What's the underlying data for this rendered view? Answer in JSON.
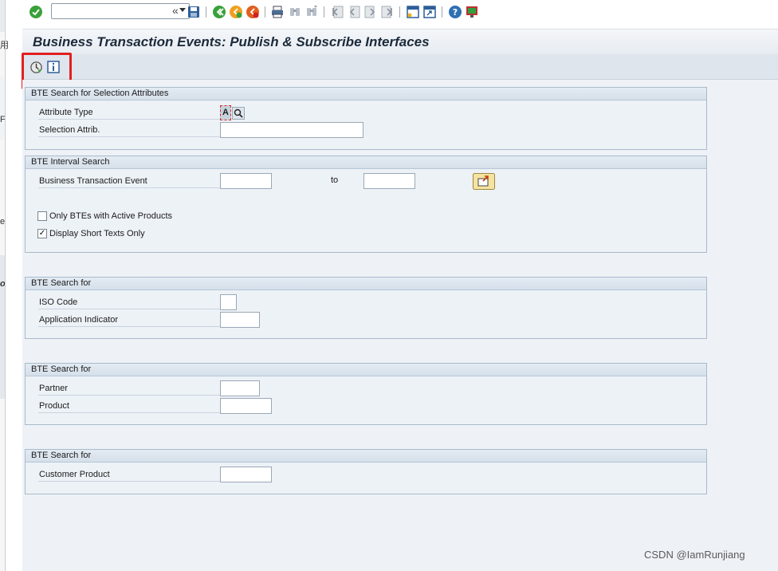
{
  "title": "Business Transaction Events: Publish & Subscribe Interfaces",
  "toolbar": {
    "back_symbol": "«",
    "icons": [
      "enter-icon",
      "save-icon",
      "back-icon",
      "exit-icon",
      "cancel-icon",
      "print-icon",
      "find-icon",
      "find-next-icon",
      "first-page-icon",
      "prev-page-icon",
      "next-page-icon",
      "last-page-icon",
      "create-session-icon",
      "shortcut-icon",
      "help-icon",
      "customize-layout-icon"
    ]
  },
  "app_toolbar": {
    "icons": [
      "execute-icon",
      "information-icon"
    ]
  },
  "groups": {
    "selection_attributes": {
      "header": "BTE Search for Selection Attributes",
      "attribute_type_label": "Attribute Type",
      "attribute_type_value": "A",
      "selection_attrib_label": "Selection Attrib.",
      "selection_attrib_value": ""
    },
    "interval": {
      "header": "BTE Interval Search",
      "bte_label": "Business Transaction Event",
      "bte_from_value": "",
      "to_label": "to",
      "bte_to_value": "",
      "only_active_label": "Only BTEs with Active Products",
      "only_active_checked": false,
      "short_texts_label": "Display Short Texts Only",
      "short_texts_checked": true,
      "check_mark": "✓"
    },
    "search_iso": {
      "header": "BTE Search for",
      "iso_label": "ISO Code",
      "app_indicator_label": "Application Indicator"
    },
    "search_partner": {
      "header": "BTE Search for",
      "partner_label": "Partner",
      "product_label": "Product"
    },
    "search_customer": {
      "header": "BTE Search for",
      "customer_product_label": "Customer Product"
    }
  },
  "left_strip": {
    "chars": [
      "用",
      "F",
      "e",
      "o"
    ]
  },
  "watermark": "CSDN @IamRunjiang",
  "colors": {
    "accent_green": "#3aa13a",
    "highlight_red": "#e02020",
    "panel_bg": "#edf2f7"
  }
}
